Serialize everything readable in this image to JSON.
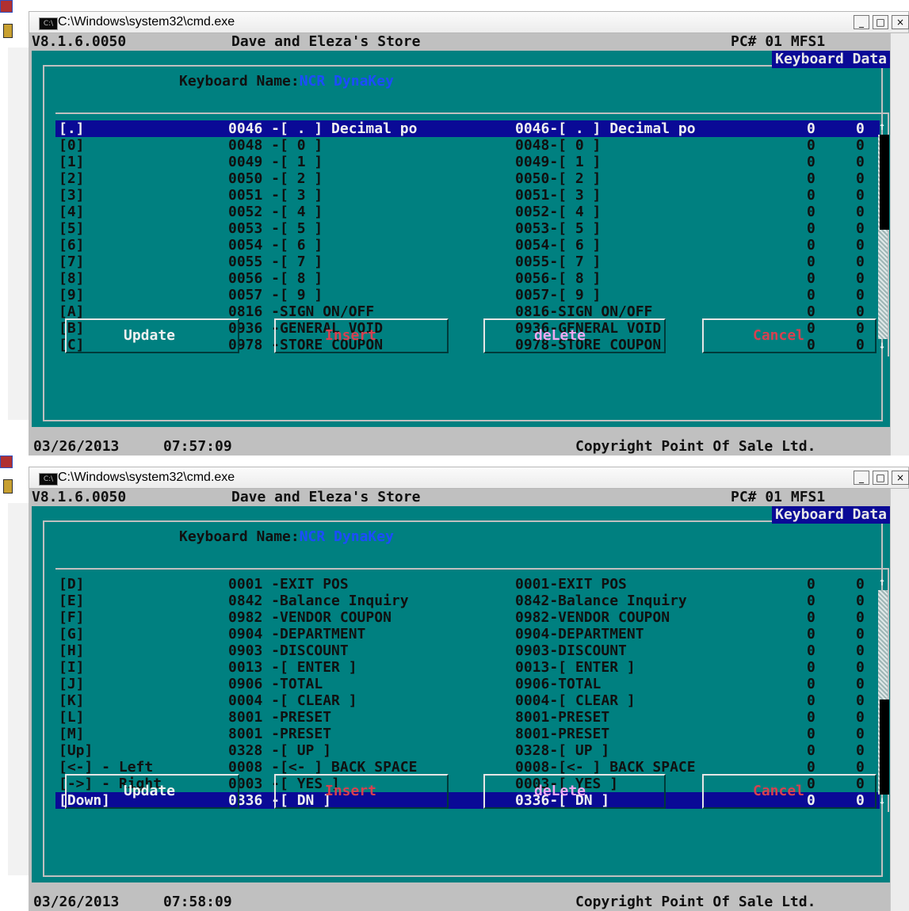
{
  "windows": [
    {
      "title": "C:\\Windows\\system32\\cmd.exe",
      "icon_text": "C:\\",
      "version": "V8.1.6.0050",
      "store": "Dave and Eleza's Store",
      "pc": "PC# 01 MFS1",
      "panel_title": "Keyboard Data",
      "kb_label": "Keyboard Name:",
      "kb_value": "NCR DynaKey",
      "rows": [
        {
          "key": "[.]",
          "code": "0046 -[ . ] Decimal po",
          "desc": "0046-[ . ] Decimal po",
          "v1": "0",
          "v2": "0",
          "selected": true
        },
        {
          "key": "[0]",
          "code": "0048 -[ 0 ]",
          "desc": "0048-[ 0 ]",
          "v1": "0",
          "v2": "0"
        },
        {
          "key": "[1]",
          "code": "0049 -[ 1 ]",
          "desc": "0049-[ 1 ]",
          "v1": "0",
          "v2": "0"
        },
        {
          "key": "[2]",
          "code": "0050 -[ 2 ]",
          "desc": "0050-[ 2 ]",
          "v1": "0",
          "v2": "0"
        },
        {
          "key": "[3]",
          "code": "0051 -[ 3 ]",
          "desc": "0051-[ 3 ]",
          "v1": "0",
          "v2": "0"
        },
        {
          "key": "[4]",
          "code": "0052 -[ 4 ]",
          "desc": "0052-[ 4 ]",
          "v1": "0",
          "v2": "0"
        },
        {
          "key": "[5]",
          "code": "0053 -[ 5 ]",
          "desc": "0053-[ 5 ]",
          "v1": "0",
          "v2": "0"
        },
        {
          "key": "[6]",
          "code": "0054 -[ 6 ]",
          "desc": "0054-[ 6 ]",
          "v1": "0",
          "v2": "0"
        },
        {
          "key": "[7]",
          "code": "0055 -[ 7 ]",
          "desc": "0055-[ 7 ]",
          "v1": "0",
          "v2": "0"
        },
        {
          "key": "[8]",
          "code": "0056 -[ 8 ]",
          "desc": "0056-[ 8 ]",
          "v1": "0",
          "v2": "0"
        },
        {
          "key": "[9]",
          "code": "0057 -[ 9 ]",
          "desc": "0057-[ 9 ]",
          "v1": "0",
          "v2": "0"
        },
        {
          "key": "[A]",
          "code": "0816 -SIGN ON/OFF",
          "desc": "0816-SIGN ON/OFF",
          "v1": "0",
          "v2": "0"
        },
        {
          "key": "[B]",
          "code": "0936 -GENERAL VOID",
          "desc": "0936-GENERAL VOID",
          "v1": "0",
          "v2": "0"
        },
        {
          "key": "[C]",
          "code": "0978 -STORE COUPON",
          "desc": "0978-STORE COUPON",
          "v1": "0",
          "v2": "0"
        }
      ],
      "buttons": [
        {
          "label": "Update",
          "color": "#f0f0f0"
        },
        {
          "label": "Insert",
          "color": "#d84050"
        },
        {
          "label": "deLete",
          "color": "#f0a8f0"
        },
        {
          "label": "Cancel",
          "color": "#d84050"
        }
      ],
      "date": "03/26/2013",
      "time": "07:57:09",
      "copyright": "Copyright Point Of Sale Ltd.",
      "scroll_position": 0.0
    },
    {
      "title": "C:\\Windows\\system32\\cmd.exe",
      "icon_text": "C:\\",
      "version": "V8.1.6.0050",
      "store": "Dave and Eleza's Store",
      "pc": "PC# 01 MFS1",
      "panel_title": "Keyboard Data",
      "kb_label": "Keyboard Name:",
      "kb_value": "NCR DynaKey",
      "rows": [
        {
          "key": "[D]",
          "code": "0001 -EXIT POS",
          "desc": "0001-EXIT POS",
          "v1": "0",
          "v2": "0"
        },
        {
          "key": "[E]",
          "code": "0842 -Balance Inquiry",
          "desc": "0842-Balance Inquiry",
          "v1": "0",
          "v2": "0"
        },
        {
          "key": "[F]",
          "code": "0982 -VENDOR COUPON",
          "desc": "0982-VENDOR COUPON",
          "v1": "0",
          "v2": "0"
        },
        {
          "key": "[G]",
          "code": "0904 -DEPARTMENT",
          "desc": "0904-DEPARTMENT",
          "v1": "0",
          "v2": "0"
        },
        {
          "key": "[H]",
          "code": "0903 -DISCOUNT",
          "desc": "0903-DISCOUNT",
          "v1": "0",
          "v2": "0"
        },
        {
          "key": "[I]",
          "code": "0013 -[ ENTER ]",
          "desc": "0013-[ ENTER ]",
          "v1": "0",
          "v2": "0"
        },
        {
          "key": "[J]",
          "code": "0906 -TOTAL",
          "desc": "0906-TOTAL",
          "v1": "0",
          "v2": "0"
        },
        {
          "key": "[K]",
          "code": "0004 -[ CLEAR ]",
          "desc": "0004-[ CLEAR ]",
          "v1": "0",
          "v2": "0"
        },
        {
          "key": "[L]",
          "code": "8001 -PRESET",
          "desc": "8001-PRESET",
          "v1": "0",
          "v2": "0"
        },
        {
          "key": "[M]",
          "code": "8001 -PRESET",
          "desc": "8001-PRESET",
          "v1": "0",
          "v2": "0"
        },
        {
          "key": "[Up]",
          "code": "0328 -[ UP ]",
          "desc": "0328-[ UP ]",
          "v1": "0",
          "v2": "0"
        },
        {
          "key": "[<-] - Left",
          "code": "0008 -[<- ] BACK SPACE",
          "desc": "0008-[<- ] BACK SPACE",
          "v1": "0",
          "v2": "0"
        },
        {
          "key": "[->] - Right",
          "code": "0003 -[ YES ]",
          "desc": "0003-[ YES ]",
          "v1": "0",
          "v2": "0"
        },
        {
          "key": "[Down]",
          "code": "0336 -[ DN ]",
          "desc": "0336-[ DN ]",
          "v1": "0",
          "v2": "0",
          "selected": true
        }
      ],
      "buttons": [
        {
          "label": "Update",
          "color": "#f0f0f0"
        },
        {
          "label": "Insert",
          "color": "#d84050"
        },
        {
          "label": "deLete",
          "color": "#f0a8f0"
        },
        {
          "label": "Cancel",
          "color": "#d84050"
        }
      ],
      "date": "03/26/2013",
      "time": "07:58:09",
      "copyright": "Copyright Point Of Sale Ltd.",
      "scroll_position": 1.0
    }
  ],
  "window_controls": {
    "minimize": "_",
    "maximize": "□",
    "close": "×"
  },
  "scroll_arrows": {
    "up": "↑",
    "down": "↓"
  }
}
